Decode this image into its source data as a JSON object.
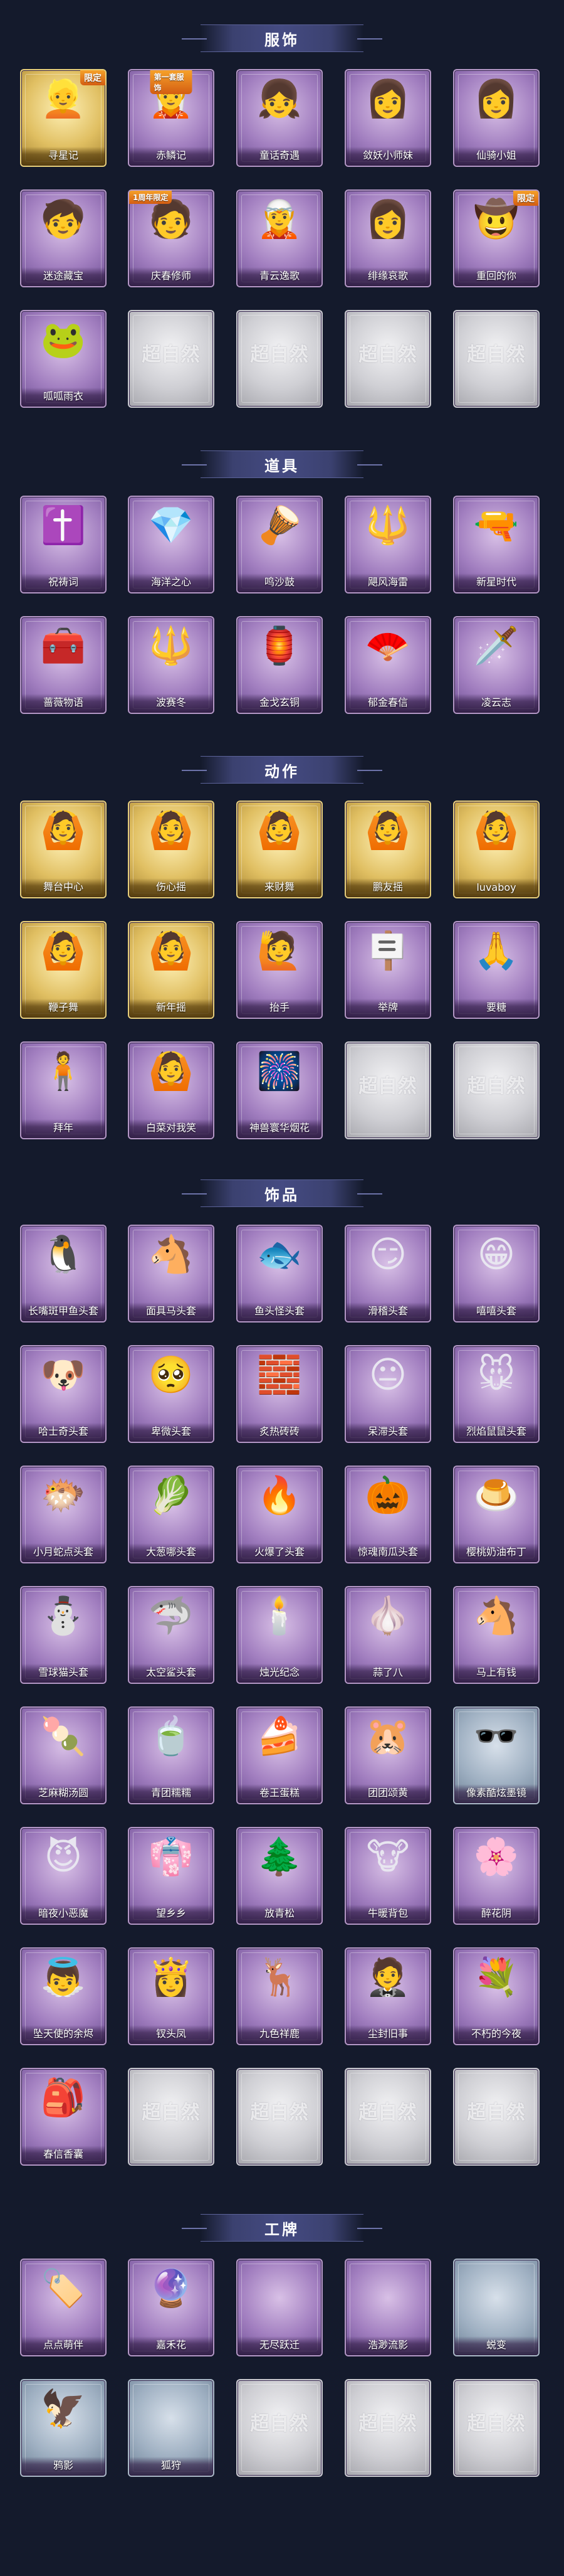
{
  "colors": {
    "background": "#141a2c",
    "purple_card": "#a27fc0",
    "gold_card": "#e0bf62",
    "grey_card": "#cfcfd4",
    "header_banner": "#454b82"
  },
  "sections": [
    {
      "title": "服饰",
      "items": [
        {
          "label": "寻星记",
          "style": "gold",
          "icon": "👱",
          "badge": "限定",
          "badge_pos": "top-right"
        },
        {
          "label": "赤鳞记",
          "style": "purple",
          "icon": "🧝",
          "badge": "第一套服饰",
          "badge_pos": "top-center"
        },
        {
          "label": "童话奇遇",
          "style": "purple",
          "icon": "👧",
          "badge": "",
          "badge_pos": ""
        },
        {
          "label": "敛妖小师妹",
          "style": "purple",
          "icon": "👩",
          "badge": "",
          "badge_pos": ""
        },
        {
          "label": "仙骑小姐",
          "style": "purple",
          "icon": "👩",
          "badge": "",
          "badge_pos": ""
        },
        {
          "label": "迷途藏宝",
          "style": "purple",
          "icon": "🧒",
          "badge": "",
          "badge_pos": ""
        },
        {
          "label": "庆春修师",
          "style": "purple",
          "icon": "🧑",
          "badge": "1周年限定",
          "badge_pos": "top-left"
        },
        {
          "label": "青云逸歌",
          "style": "purple",
          "icon": "🧝",
          "badge": "",
          "badge_pos": ""
        },
        {
          "label": "绯缘哀歌",
          "style": "purple",
          "icon": "👩",
          "badge": "",
          "badge_pos": ""
        },
        {
          "label": "重回的你",
          "style": "purple",
          "icon": "🤠",
          "badge": "限定",
          "badge_pos": "top-right"
        },
        {
          "label": "呱呱雨衣",
          "style": "purple",
          "icon": "🐸",
          "badge": "",
          "badge_pos": ""
        },
        {
          "label": "",
          "style": "grey",
          "icon": "",
          "placeholder": "超自然",
          "badge": "",
          "badge_pos": ""
        },
        {
          "label": "",
          "style": "grey",
          "icon": "",
          "placeholder": "超自然",
          "badge": "",
          "badge_pos": ""
        },
        {
          "label": "",
          "style": "grey",
          "icon": "",
          "placeholder": "超自然",
          "badge": "",
          "badge_pos": ""
        },
        {
          "label": "",
          "style": "grey",
          "icon": "",
          "placeholder": "超自然",
          "badge": "",
          "badge_pos": ""
        }
      ]
    },
    {
      "title": "道具",
      "items": [
        {
          "label": "祝祷词",
          "style": "purple",
          "icon": "✝️"
        },
        {
          "label": "海洋之心",
          "style": "purple",
          "icon": "💎"
        },
        {
          "label": "鸣沙鼓",
          "style": "purple",
          "icon": "🪘"
        },
        {
          "label": "飓风海雷",
          "style": "purple",
          "icon": "🔱"
        },
        {
          "label": "新星时代",
          "style": "purple",
          "icon": "🔫"
        },
        {
          "label": "蔷薇物语",
          "style": "purple",
          "icon": "🧰"
        },
        {
          "label": "波赛冬",
          "style": "purple",
          "icon": "🔱"
        },
        {
          "label": "金戈玄铜",
          "style": "purple",
          "icon": "🏮"
        },
        {
          "label": "郁金春信",
          "style": "purple",
          "icon": "🪭"
        },
        {
          "label": "凌云志",
          "style": "purple",
          "icon": "🗡️"
        }
      ]
    },
    {
      "title": "动作",
      "items": [
        {
          "label": "舞台中心",
          "style": "gold",
          "icon": "🙆"
        },
        {
          "label": "伤心摇",
          "style": "gold",
          "icon": "🙆"
        },
        {
          "label": "来财舞",
          "style": "gold",
          "icon": "🙆"
        },
        {
          "label": "鹏友摇",
          "style": "gold",
          "icon": "🙆"
        },
        {
          "label": "luvaboy",
          "style": "gold",
          "icon": "🙆"
        },
        {
          "label": "鞭子舞",
          "style": "gold",
          "icon": "🙆"
        },
        {
          "label": "新年摇",
          "style": "gold",
          "icon": "🙆"
        },
        {
          "label": "抬手",
          "style": "purple",
          "icon": "🙋"
        },
        {
          "label": "举牌",
          "style": "purple",
          "icon": "🪧"
        },
        {
          "label": "要糖",
          "style": "purple",
          "icon": "🙏"
        },
        {
          "label": "拜年",
          "style": "purple",
          "icon": "🧍"
        },
        {
          "label": "白菜对我笑",
          "style": "purple",
          "icon": "🙆"
        },
        {
          "label": "神兽寰华烟花",
          "style": "purple",
          "icon": "🎆"
        },
        {
          "label": "",
          "style": "grey",
          "icon": "",
          "placeholder": "超自然"
        },
        {
          "label": "",
          "style": "grey",
          "icon": "",
          "placeholder": "超自然"
        }
      ]
    },
    {
      "title": "饰品",
      "items": [
        {
          "label": "长嘴斑甲鱼头套",
          "style": "purple",
          "icon": "🐧"
        },
        {
          "label": "面具马头套",
          "style": "purple",
          "icon": "🐴"
        },
        {
          "label": "鱼头怪头套",
          "style": "purple",
          "icon": "🐟"
        },
        {
          "label": "滑稽头套",
          "style": "purple",
          "icon": "😏"
        },
        {
          "label": "嘻嘻头套",
          "style": "purple",
          "icon": "😁"
        },
        {
          "label": "哈士奇头套",
          "style": "purple",
          "icon": "🐶"
        },
        {
          "label": "卑微头套",
          "style": "purple",
          "icon": "🥺"
        },
        {
          "label": "炙热砖砖",
          "style": "purple",
          "icon": "🧱"
        },
        {
          "label": "呆滞头套",
          "style": "purple",
          "icon": "😐"
        },
        {
          "label": "烈焰鼠鼠头套",
          "style": "purple",
          "icon": "🐭"
        },
        {
          "label": "小月蛇点头套",
          "style": "purple",
          "icon": "🐡"
        },
        {
          "label": "大葱哪头套",
          "style": "purple",
          "icon": "🥬"
        },
        {
          "label": "火爆了头套",
          "style": "purple",
          "icon": "🔥"
        },
        {
          "label": "惊魂南瓜头套",
          "style": "purple",
          "icon": "🎃"
        },
        {
          "label": "樱桃奶油布丁",
          "style": "purple",
          "icon": "🍮"
        },
        {
          "label": "雪球猫头套",
          "style": "purple",
          "icon": "⛄"
        },
        {
          "label": "太空鲨头套",
          "style": "purple",
          "icon": "🦈"
        },
        {
          "label": "烛光纪念",
          "style": "purple",
          "icon": "🕯️"
        },
        {
          "label": "蒜了八",
          "style": "purple",
          "icon": "🧄"
        },
        {
          "label": "马上有钱",
          "style": "purple",
          "icon": "🐴"
        },
        {
          "label": "芝麻糊汤圆",
          "style": "purple",
          "icon": "🍡"
        },
        {
          "label": "青团糯糯",
          "style": "purple",
          "icon": "🍵"
        },
        {
          "label": "卷王蛋糕",
          "style": "purple",
          "icon": "🍰"
        },
        {
          "label": "团团颂黄",
          "style": "purple",
          "icon": "🐹"
        },
        {
          "label": "像素酷炫墨镜",
          "style": "bluegrey",
          "icon": "🕶️"
        },
        {
          "label": "暗夜小恶魔",
          "style": "purple",
          "icon": "😈"
        },
        {
          "label": "望乡乡",
          "style": "purple",
          "icon": "👘"
        },
        {
          "label": "放青松",
          "style": "purple",
          "icon": "🌲"
        },
        {
          "label": "牛暖背包",
          "style": "purple",
          "icon": "🐮"
        },
        {
          "label": "醉花阴",
          "style": "purple",
          "icon": "🌸"
        },
        {
          "label": "坠天使的余烬",
          "style": "purple",
          "icon": "👼"
        },
        {
          "label": "钗头凤",
          "style": "purple",
          "icon": "👸"
        },
        {
          "label": "九色祥鹿",
          "style": "purple",
          "icon": "🦌"
        },
        {
          "label": "尘封旧事",
          "style": "purple",
          "icon": "🤵"
        },
        {
          "label": "不朽的今夜",
          "style": "purple",
          "icon": "💐"
        },
        {
          "label": "春信香囊",
          "style": "purple",
          "icon": "🎒"
        },
        {
          "label": "",
          "style": "grey",
          "icon": "",
          "placeholder": "超自然"
        },
        {
          "label": "",
          "style": "grey",
          "icon": "",
          "placeholder": "超自然"
        },
        {
          "label": "",
          "style": "grey",
          "icon": "",
          "placeholder": "超自然"
        },
        {
          "label": "",
          "style": "grey",
          "icon": "",
          "placeholder": "超自然"
        }
      ]
    },
    {
      "title": "工牌",
      "items": [
        {
          "label": "点点萌伴",
          "style": "purple",
          "icon": "🏷️"
        },
        {
          "label": "嘉禾花",
          "style": "purple",
          "icon": "🔮"
        },
        {
          "label": "无尽跃迁",
          "style": "purple",
          "icon": ""
        },
        {
          "label": "浩渺流影",
          "style": "purple",
          "icon": ""
        },
        {
          "label": "蜕变",
          "style": "bluegrey",
          "icon": ""
        },
        {
          "label": "鸦影",
          "style": "bluegrey",
          "icon": "🦅"
        },
        {
          "label": "狐狩",
          "style": "bluegrey",
          "icon": ""
        },
        {
          "label": "",
          "style": "grey",
          "icon": "",
          "placeholder": "超自然"
        },
        {
          "label": "",
          "style": "grey",
          "icon": "",
          "placeholder": "超自然"
        },
        {
          "label": "",
          "style": "grey",
          "icon": "",
          "placeholder": "超自然"
        }
      ]
    }
  ]
}
